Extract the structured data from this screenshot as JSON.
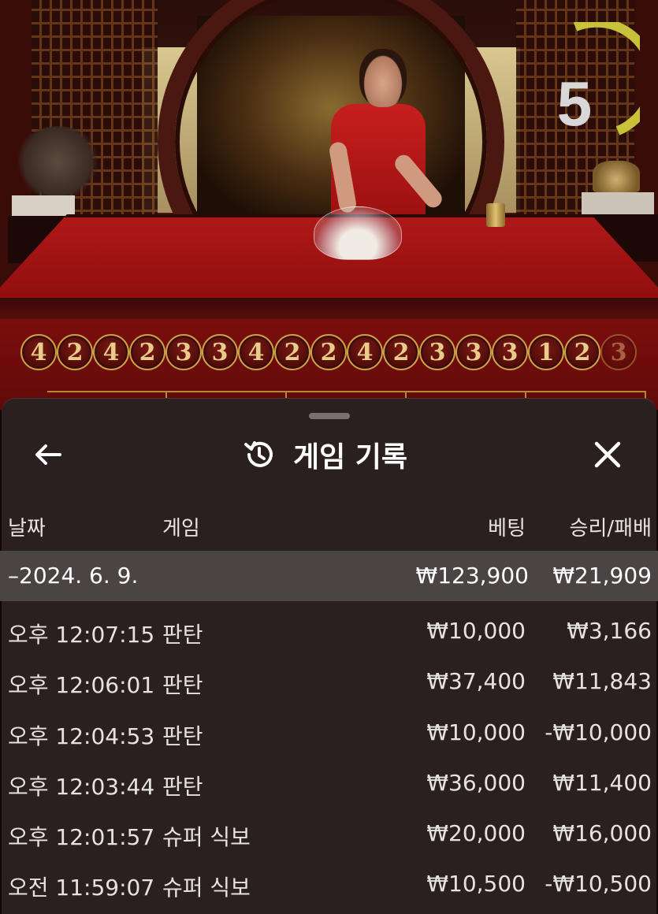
{
  "timer": {
    "value": "5",
    "progress": 0.3
  },
  "roadmap": [
    "4",
    "2",
    "4",
    "2",
    "3",
    "3",
    "4",
    "2",
    "2",
    "4",
    "2",
    "3",
    "3",
    "3",
    "1",
    "2",
    "3"
  ],
  "sheet": {
    "title": "게임 기록",
    "icons": {
      "back": "arrow-left-icon",
      "history": "history-icon",
      "close": "close-icon"
    }
  },
  "columns": {
    "date": "날짜",
    "game": "게임",
    "bet": "베팅",
    "winloss": "승리/패배"
  },
  "day": {
    "date": "–2024. 6. 9.",
    "bet": "₩123,900",
    "winloss": "₩21,909"
  },
  "rows": [
    {
      "time": "오후 12:07:15",
      "game": "판탄",
      "bet": "₩10,000",
      "winloss": "₩3,166"
    },
    {
      "time": "오후 12:06:01",
      "game": "판탄",
      "bet": "₩37,400",
      "winloss": "₩11,843"
    },
    {
      "time": "오후 12:04:53",
      "game": "판탄",
      "bet": "₩10,000",
      "winloss": "-₩10,000"
    },
    {
      "time": "오후 12:03:44",
      "game": "판탄",
      "bet": "₩36,000",
      "winloss": "₩11,400"
    },
    {
      "time": "오후 12:01:57",
      "game": "슈퍼 식보",
      "bet": "₩20,000",
      "winloss": "₩16,000"
    },
    {
      "time": "오전 11:59:07",
      "game": "슈퍼 식보",
      "bet": "₩10,500",
      "winloss": "-₩10,500"
    }
  ]
}
